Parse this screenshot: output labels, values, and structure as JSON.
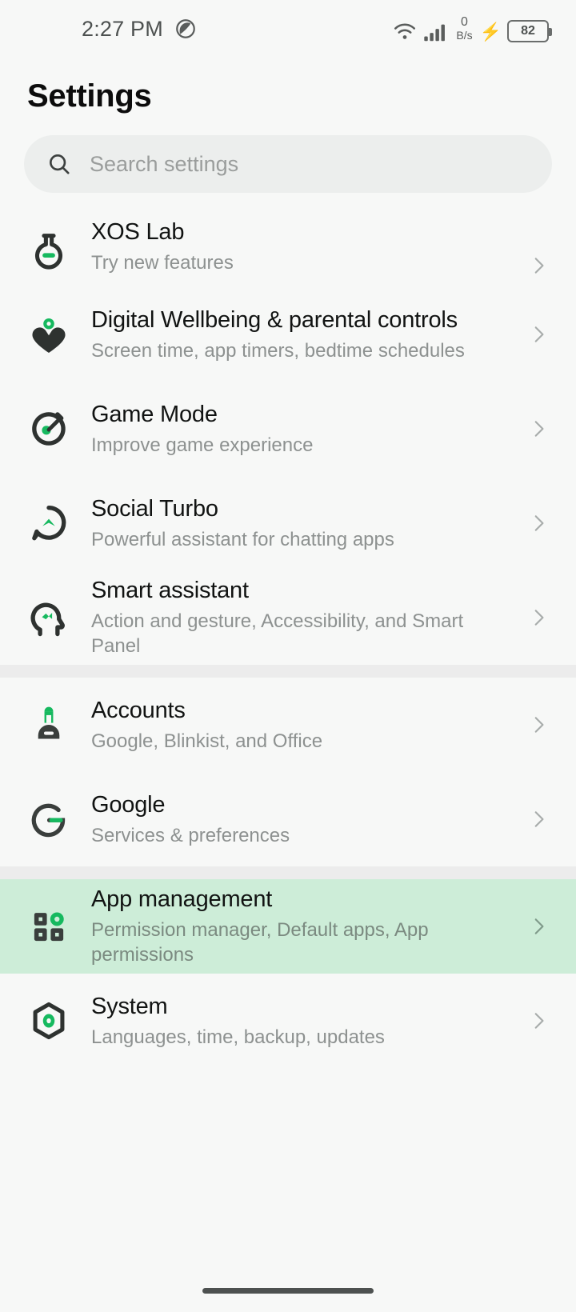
{
  "status_bar": {
    "time": "2:27 PM",
    "dnd_icon": "do-not-disturb-icon",
    "wifi_icon": "wifi-icon",
    "signal_icon": "cellular-signal-icon",
    "network_speed_value": "0",
    "network_speed_unit": "B/s",
    "charging_icon": "charging-bolt-icon",
    "battery_level": "82"
  },
  "header": {
    "title": "Settings"
  },
  "search": {
    "icon": "search-icon",
    "placeholder": "Search settings",
    "value": ""
  },
  "colors": {
    "accent_green": "#16b95f",
    "highlight_green": "#cdedd8",
    "page_background": "#f7f8f7",
    "divider_grey": "#ececec",
    "title_text": "#111312",
    "subtitle_text": "#8d9190"
  },
  "groups": [
    {
      "id": "group-features",
      "items": [
        {
          "id": "xos-lab",
          "title": "XOS Lab",
          "subtitle": "Try new features",
          "icon": "flask-icon",
          "chevron": "chevron-right-icon",
          "highlighted": false,
          "clipped": true
        },
        {
          "id": "digital-wellbeing",
          "title": "Digital Wellbeing & parental controls",
          "subtitle": "Screen time, app timers, bedtime schedules",
          "icon": "heart-icon",
          "chevron": "chevron-right-icon",
          "highlighted": false
        },
        {
          "id": "game-mode",
          "title": "Game Mode",
          "subtitle": "Improve game experience",
          "icon": "speedometer-icon",
          "chevron": "chevron-right-icon",
          "highlighted": false
        },
        {
          "id": "social-turbo",
          "title": "Social Turbo",
          "subtitle": "Powerful assistant for chatting apps",
          "icon": "chat-bubble-icon",
          "chevron": "chevron-right-icon",
          "highlighted": false
        },
        {
          "id": "smart-assistant",
          "title": "Smart assistant",
          "subtitle": "Action and gesture, Accessibility, and Smart Panel",
          "icon": "head-profile-icon",
          "chevron": "chevron-right-icon",
          "highlighted": false
        }
      ]
    },
    {
      "id": "group-accounts",
      "items": [
        {
          "id": "accounts",
          "title": "Accounts",
          "subtitle": "Google, Blinkist, and Office",
          "icon": "person-account-icon",
          "chevron": "chevron-right-icon",
          "highlighted": false
        },
        {
          "id": "google",
          "title": "Google",
          "subtitle": "Services & preferences",
          "icon": "google-g-icon",
          "chevron": "chevron-right-icon",
          "highlighted": false
        }
      ]
    },
    {
      "id": "group-system",
      "items": [
        {
          "id": "app-management",
          "title": "App management",
          "subtitle": "Permission manager, Default apps, App permissions",
          "icon": "apps-grid-icon",
          "chevron": "chevron-right-icon",
          "highlighted": true
        },
        {
          "id": "system",
          "title": "System",
          "subtitle": "Languages, time, backup, updates",
          "icon": "hexagon-gear-icon",
          "chevron": "chevron-right-icon",
          "highlighted": false
        }
      ]
    }
  ],
  "nav_bar": {
    "gesture_pill": "home-gesture-pill"
  }
}
